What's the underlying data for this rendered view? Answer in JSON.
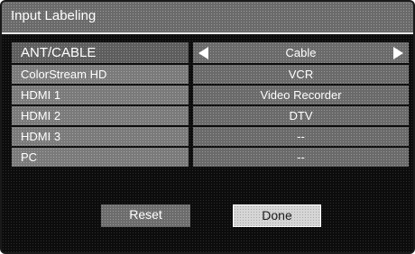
{
  "title": "Input Labeling",
  "rows": [
    {
      "label": "ANT/CABLE",
      "value": "Cable",
      "selected": true
    },
    {
      "label": "ColorStream HD",
      "value": "VCR",
      "selected": false
    },
    {
      "label": "HDMI 1",
      "value": "Video Recorder",
      "selected": false
    },
    {
      "label": "HDMI 2",
      "value": "DTV",
      "selected": false
    },
    {
      "label": "HDMI 3",
      "value": "--",
      "selected": false
    },
    {
      "label": "PC",
      "value": "--",
      "selected": false
    }
  ],
  "buttons": {
    "reset": "Reset",
    "done": "Done"
  },
  "icons": {
    "left_arrow": "triangle-left-icon",
    "right_arrow": "triangle-right-icon"
  },
  "colors": {
    "background": "#0c0c0c",
    "title_bar": "#6a6a6a",
    "cell": "#7a7a7a",
    "selected_cell": "#5d5d5d",
    "done_button": "#d6d6d6"
  }
}
